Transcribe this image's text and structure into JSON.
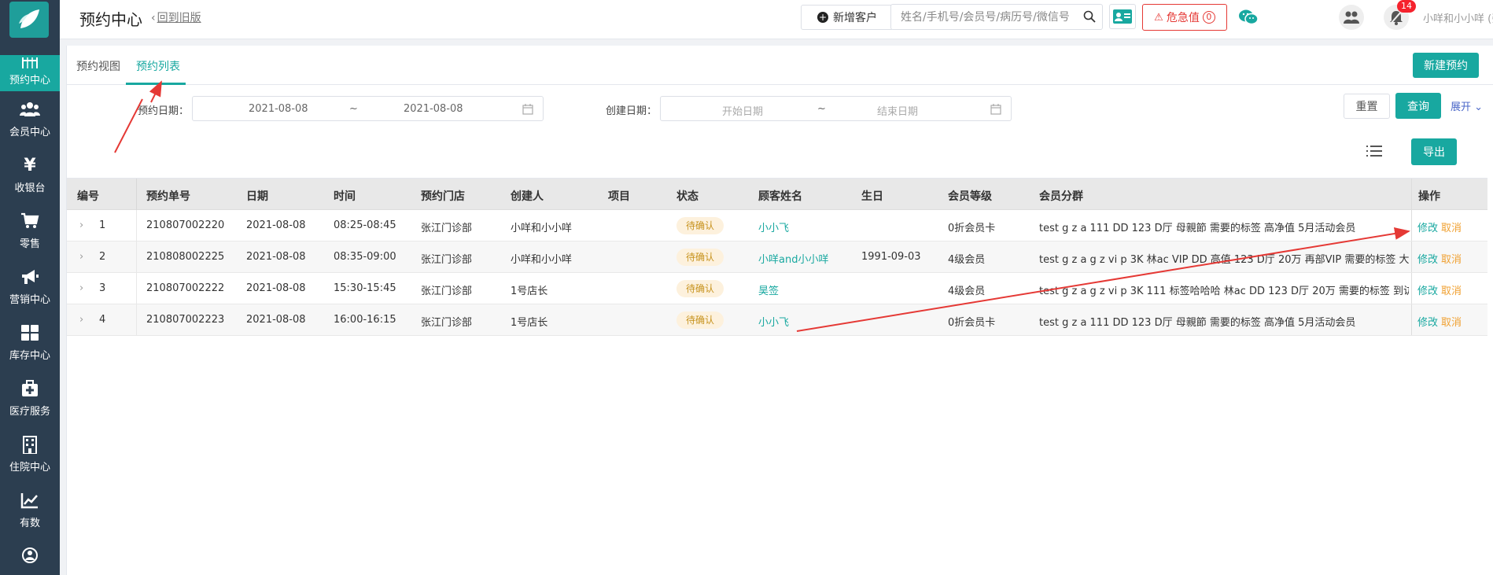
{
  "header": {
    "title": "预约中心",
    "back_link": "回到旧版",
    "add_customer": "新增客户",
    "search_placeholder": "姓名/手机号/会员号/病历号/微信号",
    "danger_label": "危急值",
    "danger_count": "0",
    "notification_count": "14",
    "user": "小咩和小小咩 (张江门诊部)"
  },
  "sidebar": {
    "items": [
      {
        "label": "预约中心",
        "icon": "calendar-icon"
      },
      {
        "label": "会员中心",
        "icon": "users-icon"
      },
      {
        "label": "收银台",
        "icon": "yen-icon"
      },
      {
        "label": "零售",
        "icon": "cart-icon"
      },
      {
        "label": "营销中心",
        "icon": "megaphone-icon"
      },
      {
        "label": "库存中心",
        "icon": "grid-icon"
      },
      {
        "label": "医疗服务",
        "icon": "medkit-icon"
      },
      {
        "label": "住院中心",
        "icon": "building-icon"
      },
      {
        "label": "有数",
        "icon": "chart-icon"
      }
    ]
  },
  "tabs": {
    "view": "预约视图",
    "list": "预约列表"
  },
  "toolbar": {
    "new_appointment": "新建预约",
    "reset": "重置",
    "query": "查询",
    "expand": "展开",
    "export": "导出"
  },
  "filters": {
    "appt_date_label": "预约日期：",
    "appt_date_start": "2021-08-08",
    "appt_date_end": "2021-08-08",
    "tilde": "~",
    "create_date_label": "创建日期：",
    "create_start_placeholder": "开始日期",
    "create_end_placeholder": "结束日期"
  },
  "table": {
    "columns": [
      "编号",
      "预约单号",
      "日期",
      "时间",
      "预约门店",
      "创建人",
      "项目",
      "状态",
      "顾客姓名",
      "生日",
      "会员等级",
      "会员分群",
      "操作"
    ],
    "rows": [
      {
        "no": "1",
        "order": "210807002220",
        "date": "2021-08-08",
        "time": "08:25-08:45",
        "store": "张江门诊部",
        "creator": "小咩和小小咩",
        "project": "",
        "status": "待确认",
        "customer": "小小飞",
        "birthday": "",
        "level": "0折会员卡",
        "group": "test g z a 111 DD 123 D厅 母親節 需要的标签 高净值 5月活动会员"
      },
      {
        "no": "2",
        "order": "210808002225",
        "date": "2021-08-08",
        "time": "08:35-09:00",
        "store": "张江门诊部",
        "creator": "小咩和小小咩",
        "project": "",
        "status": "待确认",
        "customer": "小咩and小小咩",
        "birthday": "1991-09-03",
        "level": "4级会员",
        "group": "test g z a g z vi p 3K 林ac VIP DD 高值 123 D厅 20万 再部VIP 需要的标签 大客户 到"
      },
      {
        "no": "3",
        "order": "210807002222",
        "date": "2021-08-08",
        "time": "15:30-15:45",
        "store": "张江门诊部",
        "creator": "1号店长",
        "project": "",
        "status": "待确认",
        "customer": "昊签",
        "birthday": "",
        "level": "4级会员",
        "group": "test g z a g z vi p 3K 111 标签哈哈哈 林ac DD 123 D厅 20万 需要的标签 到访未消费"
      },
      {
        "no": "4",
        "order": "210807002223",
        "date": "2021-08-08",
        "time": "16:00-16:15",
        "store": "张江门诊部",
        "creator": "1号店长",
        "project": "",
        "status": "待确认",
        "customer": "小小飞",
        "birthday": "",
        "level": "0折会员卡",
        "group": "test g z a 111 DD 123 D厅 母親節 需要的标签 高净值 5月活动会员"
      }
    ],
    "edit_label": "修改",
    "cancel_label": "取消"
  },
  "colors": {
    "accent": "#18a8a0",
    "sidebar": "#2c3e50",
    "danger": "#e53935",
    "cancel": "#f0a030",
    "annotation": "#e53935"
  }
}
